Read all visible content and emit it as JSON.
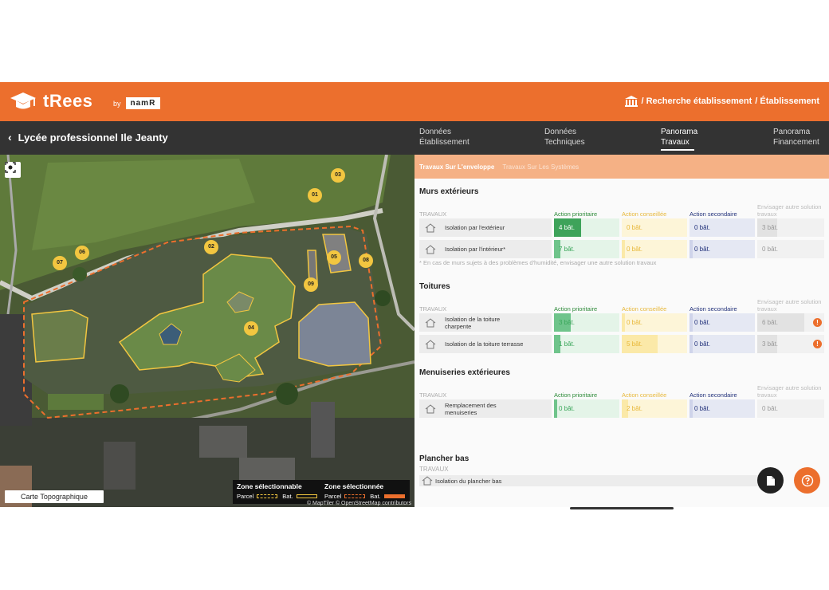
{
  "header": {
    "app_name": "tRees",
    "by": "by",
    "partner": "namR",
    "breadcrumb_1": "/ Recherche établissement",
    "breadcrumb_2": "/ Établissement"
  },
  "subheader": {
    "title": "Lycée professionnel Ile Jeanty",
    "tabs": [
      {
        "line1": "Données",
        "line2": "Établissement"
      },
      {
        "line1": "Données",
        "line2": "Techniques"
      },
      {
        "line1": "Panorama",
        "line2": "Travaux"
      },
      {
        "line1": "Panorama",
        "line2": "Financement"
      }
    ]
  },
  "map": {
    "buildings": [
      "01",
      "02",
      "03",
      "04",
      "05",
      "06",
      "07",
      "08",
      "09"
    ],
    "topo_button": "Carte Topographique",
    "legend": {
      "selectable": "Zone sélectionnable",
      "selected": "Zone sélectionnée",
      "parcel": "Parcel",
      "bat": "Bat."
    },
    "attribution": "© MapTiler © OpenStreetMap contributors"
  },
  "panel": {
    "subtabs": [
      "Travaux Sur L'enveloppe",
      "Travaux Sur Les Systèmes"
    ],
    "headers": {
      "travaux": "TRAVAUX",
      "prio": "Action prioritaire",
      "cons": "Action conseillée",
      "seco": "Action secondaire",
      "envi": "Envisager autre solution travaux"
    },
    "sections": {
      "murs": {
        "title": "Murs extérieurs",
        "rows": [
          {
            "label": "Isolation par l'extérieur",
            "prio": "4 bât.",
            "cons": "0 bât.",
            "seco": "0 bât.",
            "envi": "3 bât."
          },
          {
            "label": "Isolation par l'intérieur*",
            "prio": "7 bât.",
            "cons": "0 bât.",
            "seco": "0 bât.",
            "envi": "0 bât."
          }
        ],
        "note": "* En cas de murs sujets à des problèmes d'humidité, envisager une autre solution travaux"
      },
      "toitures": {
        "title": "Toitures",
        "rows": [
          {
            "label": "Isolation de la toiture charpente",
            "prio": "3 bât.",
            "cons": "0 bât.",
            "seco": "0 bât.",
            "envi": "6 bât."
          },
          {
            "label": "Isolation de la toiture terrasse",
            "prio": "1 bât.",
            "cons": "5 bât.",
            "seco": "0 bât.",
            "envi": "3 bât."
          }
        ]
      },
      "menuiseries": {
        "title": "Menuiseries extérieures",
        "rows": [
          {
            "label": "Remplacement des menuiseries",
            "prio": "0 bât.",
            "cons": "2 bât.",
            "seco": "0 bât.",
            "envi": "0 bât."
          }
        ]
      },
      "plancher": {
        "title": "Plancher bas",
        "rows": [
          {
            "label": "Isolation du plancher bas"
          }
        ]
      }
    },
    "warn_glyph": "!"
  },
  "colors": {
    "brand": "#ec6f2d",
    "dark": "#333333",
    "prio": "#3ea35a",
    "cons": "#e8b83a",
    "seco": "#22317a"
  }
}
